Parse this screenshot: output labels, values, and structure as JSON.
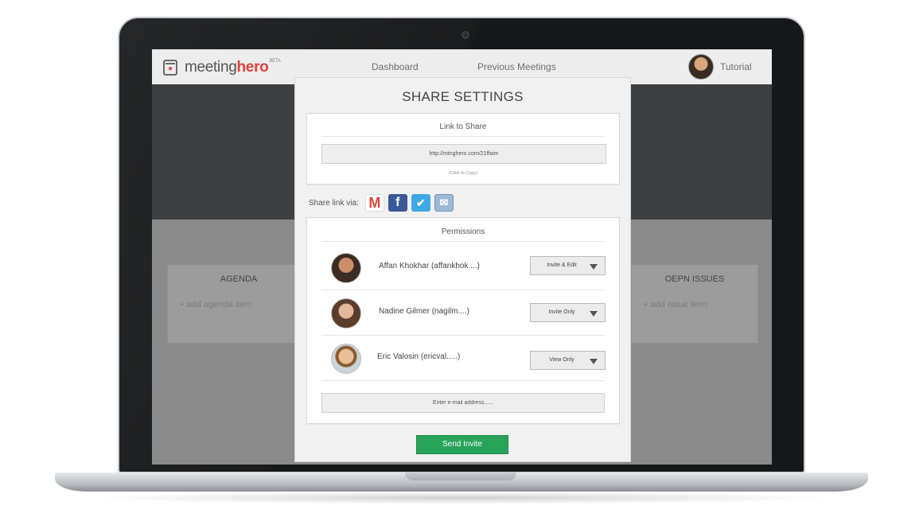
{
  "app": {
    "logo_main": "meeting",
    "logo_accent": "hero",
    "logo_badge": "BETA",
    "nav": [
      "Dashboard",
      "Previous Meetings"
    ],
    "tutorial_label": "Tutorial",
    "panels": {
      "agenda_title": "AGENDA",
      "agenda_add": "add agenda item",
      "issues_title": "OEPN ISSUES",
      "issues_add": "add issue item"
    }
  },
  "modal": {
    "title": "SHARE SETTINGS",
    "link_section": {
      "header": "Link to Share",
      "url": "http://mtnghero.com/21ffaim",
      "hint": "(Click to Copy)"
    },
    "share": {
      "label": "Share link via:",
      "icons": [
        "gmail-icon",
        "facebook-icon",
        "twitter-icon",
        "mail-icon"
      ]
    },
    "permissions": {
      "header": "Permissions",
      "people": [
        {
          "name": "Affan Khokhar (affankhok....)",
          "permission": "Invite & Edit"
        },
        {
          "name": "Nadine Gilmer (nagilm....)",
          "permission": "Invite Only"
        },
        {
          "name": "Eric Valosin (ericval.....)",
          "permission": "View Only"
        }
      ],
      "email_placeholder": "Enter e-mail address......"
    },
    "send_label": "Send Invite"
  },
  "colors": {
    "accent_red": "#d9423a",
    "send_green": "#27a35a",
    "facebook_blue": "#3b5998",
    "twitter_blue": "#3fa9e6"
  }
}
